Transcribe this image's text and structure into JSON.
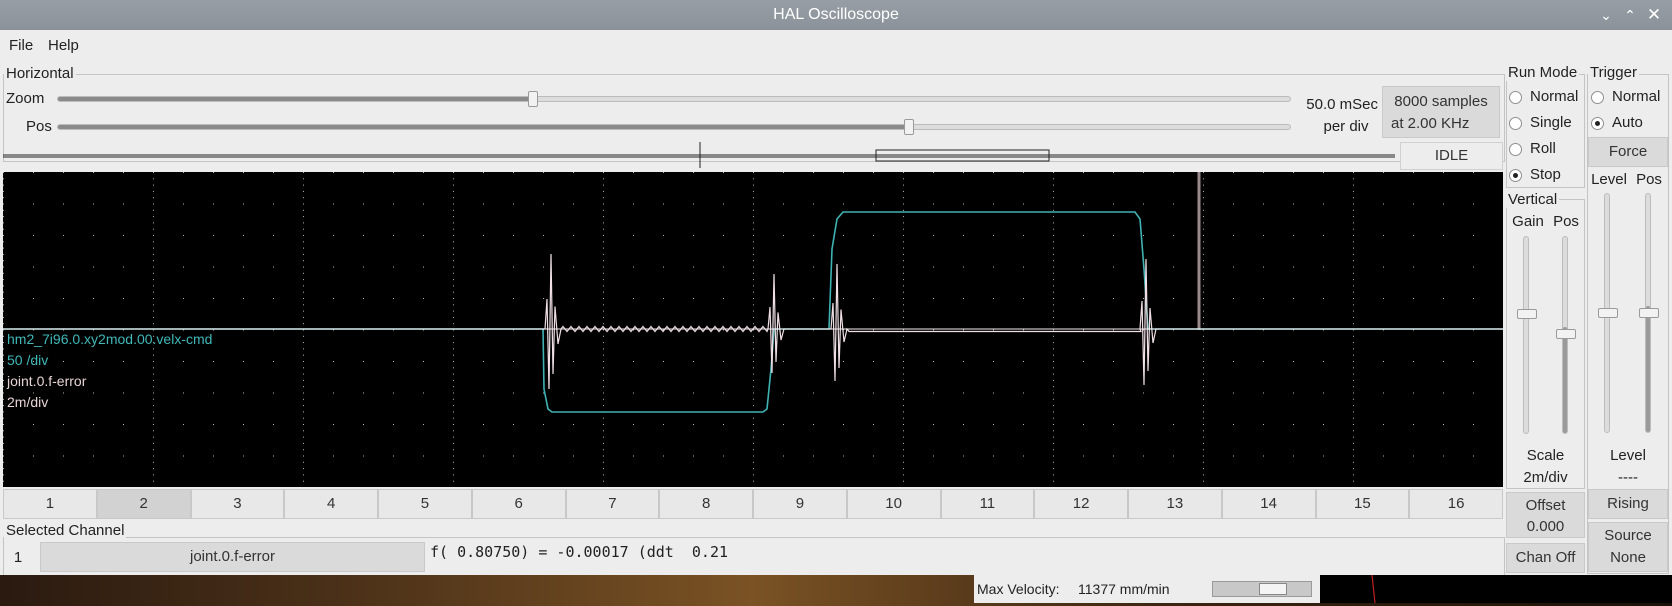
{
  "window": {
    "title": "HAL Oscilloscope"
  },
  "menu": {
    "file": "File",
    "help": "Help"
  },
  "horizontal": {
    "group_label": "Horizontal",
    "zoom_label": "Zoom",
    "pos_label": "Pos",
    "zoom_level": 0.385,
    "pos_level": 0.69,
    "rate_line1": "50.0 mSec",
    "rate_line2": "per div",
    "samples_line1": "8000 samples",
    "samples_line2": "at 2.00 KHz",
    "status": "IDLE"
  },
  "run_mode": {
    "group_label": "Run Mode",
    "options": [
      "Normal",
      "Single",
      "Roll",
      "Stop"
    ],
    "selected": "Stop"
  },
  "trigger": {
    "group_label": "Trigger",
    "options": [
      "Normal",
      "Auto"
    ],
    "selected": "Auto",
    "force_label": "Force",
    "level_label": "Level",
    "pos_label": "Pos",
    "level_caption": "Level",
    "level_value": "----",
    "edge_label": "Rising",
    "source_line1": "Source",
    "source_line2": "None"
  },
  "vertical": {
    "group_label": "Vertical",
    "gain_label": "Gain",
    "pos_label": "Pos",
    "scale_caption": "Scale",
    "scale_value": "2m/div",
    "offset_caption": "Offset",
    "offset_value": "0.000",
    "chan_off_label": "Chan Off"
  },
  "screen": {
    "labels": [
      {
        "text": "hm2_7i96.0.xy2mod.00.velx-cmd",
        "color": "#40b8b8"
      },
      {
        "text": "50 /div",
        "color": "#40b8b8"
      },
      {
        "text": "joint.0.f-error",
        "color": "#e8d4d4"
      },
      {
        "text": "2m/div",
        "color": "#e8d4d4"
      }
    ],
    "trace_colors": {
      "velx": "#3fb2b4",
      "ferror": "#f0e0e6",
      "cursor": "#9a8a8c"
    }
  },
  "channels": {
    "tabs": [
      "1",
      "2",
      "3",
      "4",
      "5",
      "6",
      "7",
      "8",
      "9",
      "10",
      "11",
      "12",
      "13",
      "14",
      "15",
      "16"
    ],
    "active": "2"
  },
  "selected_channel": {
    "group_label": "Selected Channel",
    "number": "1",
    "name": "joint.0.f-error",
    "readout": "f( 0.80750) = -0.00017 (ddt  0.21"
  },
  "status_strip": {
    "max_velocity_label": "Max Velocity:",
    "max_velocity_value": "11377 mm/min"
  }
}
